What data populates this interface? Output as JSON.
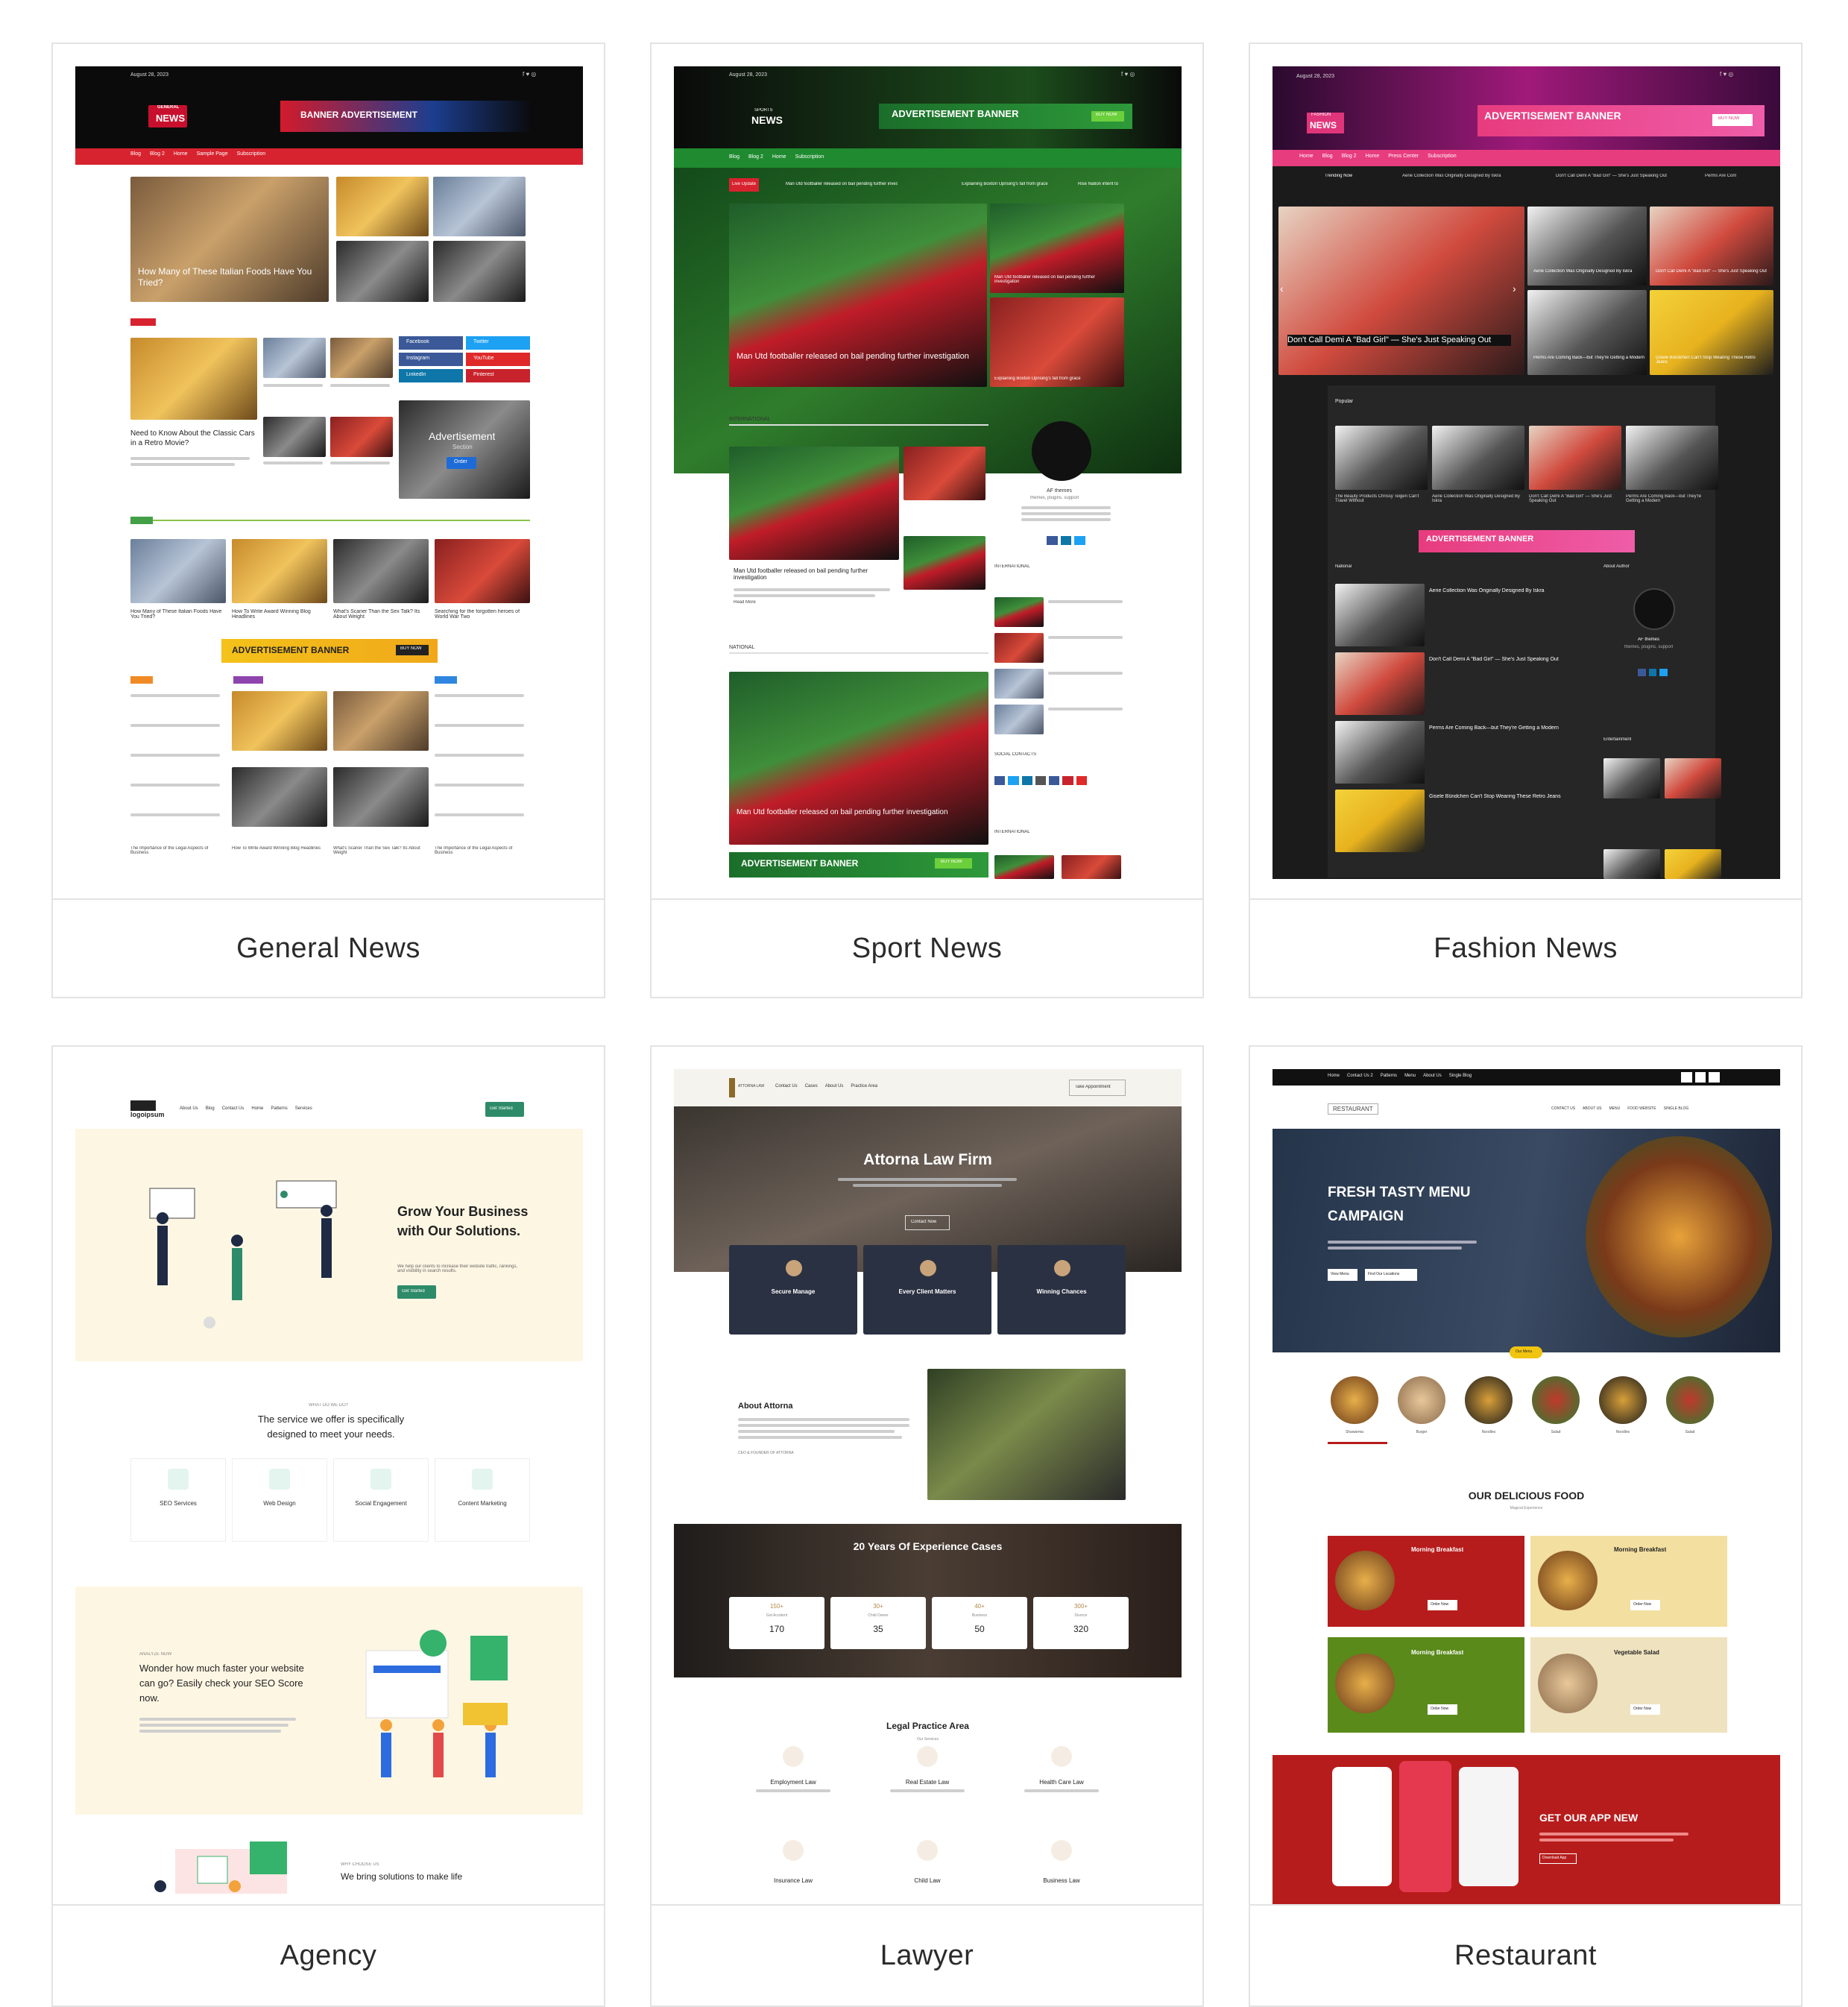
{
  "cards": [
    {
      "title": "General News",
      "preview": {
        "date": "August 28, 2023",
        "logo_top": "GENERAL",
        "logo_main": "NEWS",
        "banner": "BANNER ADVERTISEMENT",
        "nav": [
          "Blog",
          "Blog 2",
          "Home",
          "Sample Page",
          "Subscription"
        ],
        "hero_headline": "How Many of These Italian Foods Have You Tried?",
        "side_items": [
          "Need to Know About the Classic Cars in a Retro Movie?",
          "How Many of These Italian Foods Have You Tried?",
          "How To Write Award Winning Blog Headlines",
          "What's Scarier Than the Sex Talk? Its About Weight"
        ],
        "trending_title": "Need to Know About the Classic Cars in a Retro Movie?",
        "social": [
          "Facebook",
          "Twitter",
          "Instagram",
          "YouTube",
          "LinkedIn",
          "Pinterest"
        ],
        "ad_box_title": "Advertisement",
        "ad_box_sub": "Section",
        "ad_box_button": "Order",
        "popular_items": [
          "How Many of These Italian Foods Have You Tried?",
          "How To Write Award Winning Blog Headlines",
          "What's Scarier Than the Sex Talk? Its About Weight",
          "Searching for the forgotten heroes of World War Two"
        ],
        "ad_banner": "ADVERTISEMENT BANNER",
        "ad_banner_button": "BUY NOW",
        "footer_items": [
          "The Importance of the Legal Aspects of Business",
          "How To Write Award Winning Blog Headlines",
          "What's Scarier Than the Sex Talk? Its About Weight",
          "The Importance of the Legal Aspects of Business"
        ]
      }
    },
    {
      "title": "Sport News",
      "preview": {
        "date": "August 28, 2023",
        "logo_top": "SPORTS",
        "logo_main": "NEWS",
        "banner": "ADVERTISEMENT BANNER",
        "banner_button": "BUY NOW",
        "nav": [
          "Blog",
          "Blog 2",
          "Home",
          "Subscription"
        ],
        "ticker_label": "Live Update",
        "ticker_items": [
          "Man Utd footballer released on bail pending further investigation",
          "Explaining Boxton Uprising's fall from grace",
          "Rise Nation intent to"
        ],
        "hero_headline": "Man Utd footballer released on bail pending further investigation",
        "hero_side": [
          "Man Utd footballer released on bail pending further investigation",
          "Explaining Boxton Uprising's fall from grace"
        ],
        "section_international": "INTERNATIONAL",
        "section_national": "NATIONAL",
        "section_social": "SOCIAL CONTACTS",
        "article_title": "Man Utd footballer released on bail pending further investigation",
        "read_more": "Read More",
        "author_name": "AF themes",
        "author_tag": "themes, plugins, support",
        "ad_banner": "ADVERTISEMENT BANNER",
        "ad_banner_button": "BUY NOW"
      }
    },
    {
      "title": "Fashion News",
      "preview": {
        "date": "August 28, 2023",
        "logo_top": "FASHION",
        "logo_main": "NEWS",
        "banner": "ADVERTISEMENT BANNER",
        "banner_button": "BUY NOW",
        "nav": [
          "Home",
          "Blog",
          "Blog 2",
          "Home",
          "Press Center",
          "Subscription"
        ],
        "trending_label": "Trending Now",
        "trending_items": [
          "Aerie Collection Was Originally Designed By Iskra",
          "Don't Call Demi A \"Bad Girl\" — She's Just Speaking Out",
          "Perms Are Com"
        ],
        "hero_headline": "Don't Call Demi A \"Bad Girl\" — She's Just Speaking Out",
        "hero_side": [
          "Aerie Collection Was Originally Designed By Iskra",
          "Don't Call Demi A \"Bad Girl\" — She's Just Speaking Out",
          "Perms Are Coming Back—but They're Getting a Modern",
          "Gisele Bündchen Can't Stop Wearing These Retro Jeans"
        ],
        "section_popular": "Popular",
        "popular_items": [
          "The Beauty Products Chrissy Teigen Can't Travel Without",
          "Aerie Collection Was Originally Designed By Iskra",
          "Don't Call Demi A \"Bad Girl\" — She's Just Speaking Out",
          "Perms Are Coming Back—but They're Getting a Modern"
        ],
        "ad_banner": "ADVERTISEMENT BANNER",
        "section_national": "National",
        "section_about": "About Author",
        "section_entertainment": "Entertainment",
        "list_items": [
          "Aerie Collection Was Originally Designed By Iskra",
          "Don't Call Demi A \"Bad Girl\" — She's Just Speaking Out",
          "Perms Are Coming Back—but They're Getting a Modern",
          "Gisele Bündchen Can't Stop Wearing These Retro Jeans"
        ],
        "author_name": "AF themes",
        "author_tag": "themes, plugins, support"
      }
    },
    {
      "title": "Agency",
      "preview": {
        "logo": "logoipsum",
        "nav": [
          "About Us",
          "Blog",
          "Contact Us",
          "Home",
          "Patterns",
          "Services"
        ],
        "nav_button": "Get Started",
        "hero_title": "Grow Your Business with Our Solutions.",
        "hero_text": "We help our clients to increase their website traffic, rankings, and visibility in search results.",
        "hero_button": "Get Started",
        "services_kicker": "WHAT DO WE DO?",
        "services_title": "The service we offer is specifically designed to meet your needs.",
        "services": [
          "SEO Services",
          "Web Design",
          "Social Engagement",
          "Content Marketing"
        ],
        "seo_kicker": "ANALYZE NOW",
        "seo_title": "Wonder how much faster your website can go? Easily check your SEO Score now.",
        "bottom_kicker": "WHY CHOOSE US",
        "bottom_title": "We bring solutions to make life"
      }
    },
    {
      "title": "Lawyer",
      "preview": {
        "logo": "ATTORNA LAW",
        "nav": [
          "Contact Us",
          "Cases",
          "About Us",
          "Practice Area"
        ],
        "nav_button": "Take Appointment",
        "hero_title": "Attorna Law Firm",
        "hero_button": "Contact Now",
        "features": [
          "Secure Manage",
          "Every Client Matters",
          "Winning Chances"
        ],
        "about_title": "About Attorna",
        "about_sig": "CEO & FOUNDER OF ATTORNA",
        "exp_title": "20 Years Of Experience Cases",
        "stats": [
          {
            "top": "150+",
            "label": "Got Accident",
            "value": "170"
          },
          {
            "top": "30+",
            "label": "Child Owner",
            "value": "35"
          },
          {
            "top": "40+",
            "label": "Business",
            "value": "50"
          },
          {
            "top": "300+",
            "label": "Divorce",
            "value": "320"
          }
        ],
        "practice_title": "Legal Practice Area",
        "practice_sub": "Our Services",
        "practice_items": [
          "Employment Law",
          "Real Estate Law",
          "Health Care Law"
        ],
        "practice_items_2": [
          "Insurance Law",
          "Child Law",
          "Business Law"
        ]
      }
    },
    {
      "title": "Restaurant",
      "preview": {
        "top_nav": [
          "Home",
          "Contact Us 2",
          "Patterns",
          "Menu",
          "About Us",
          "Single Blog"
        ],
        "logo": "RESTAURANT",
        "main_nav": [
          "CONTACT US",
          "ABOUT US",
          "MENU",
          "FOOD WEBSITE",
          "SINGLE BLOG"
        ],
        "hero_title": "FRESH TASTY MENU CAMPAIGN",
        "hero_btn_1": "View Menu",
        "hero_btn_2": "Find Our Locations",
        "pill": "Our Menu",
        "categories": [
          "Shawarma",
          "Burger",
          "Noodles",
          "Salad",
          "Noodles",
          "Salad"
        ],
        "food_title": "OUR DELICIOUS FOOD",
        "food_sub": "Magical Experience",
        "food_cards": [
          "Morning Breakfast",
          "Morning Breakfast",
          "Morning Breakfast",
          "Vegetable Salad"
        ],
        "order_button": "Order Now",
        "app_title": "GET OUR APP NEW",
        "app_button": "Download App"
      }
    }
  ]
}
